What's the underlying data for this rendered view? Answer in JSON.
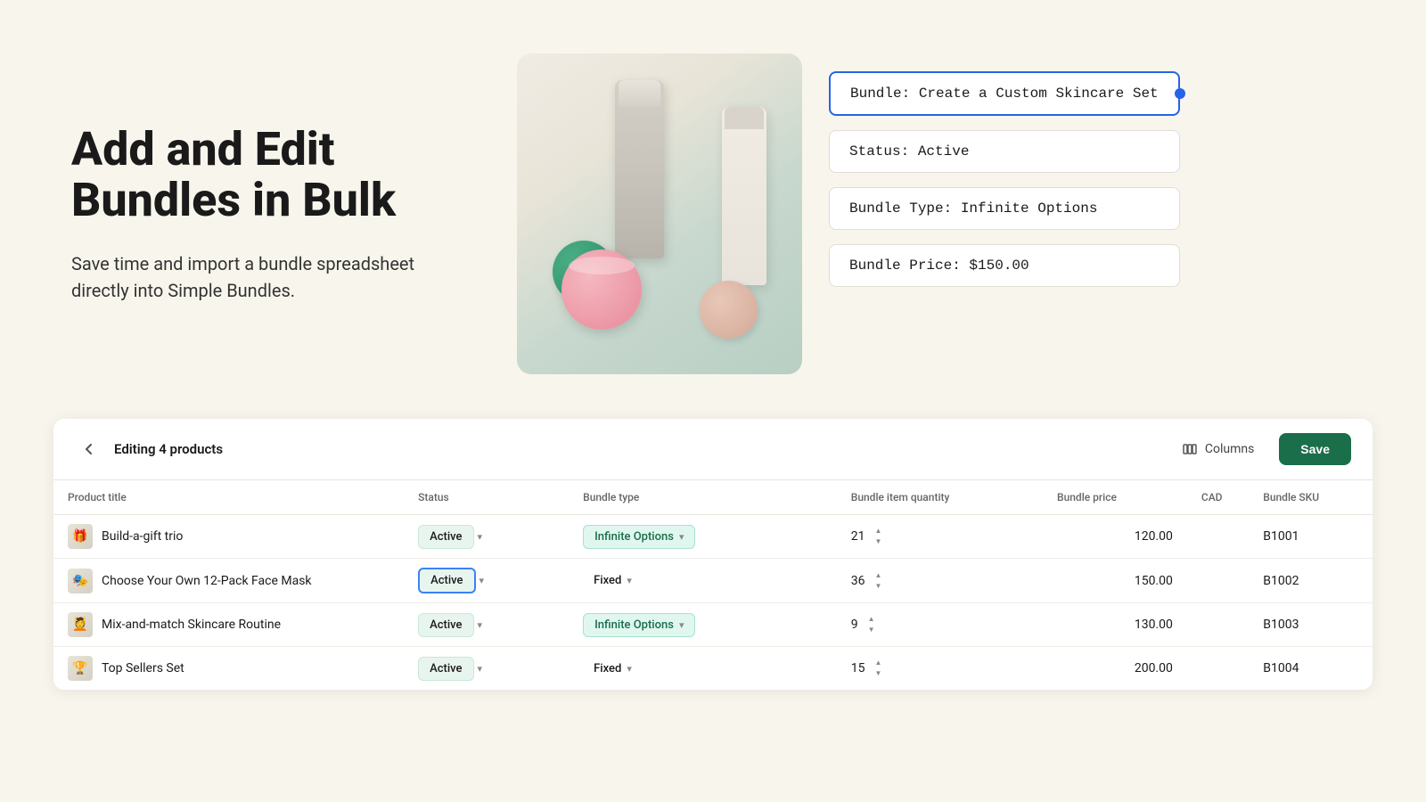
{
  "hero": {
    "title": "Add and Edit Bundles in Bulk",
    "subtitle": "Save time and import a bundle spreadsheet directly into Simple Bundles.",
    "info_cards": [
      {
        "label": "Bundle:",
        "value": "Create a Custom Skincare Set",
        "highlighted": true
      },
      {
        "label": "Status:",
        "value": "Active",
        "highlighted": false
      },
      {
        "label": "Bundle Type:",
        "value": "Infinite Options",
        "highlighted": false
      },
      {
        "label": "Bundle Price:",
        "value": "$150.00",
        "highlighted": false
      }
    ]
  },
  "table": {
    "editing_label": "Editing 4 products",
    "columns_label": "Columns",
    "save_label": "Save",
    "headers": [
      "Product title",
      "Status",
      "Bundle type",
      "Bundle item quantity",
      "Bundle price",
      "CAD",
      "Bundle SKU"
    ],
    "rows": [
      {
        "id": 1,
        "thumb": "🎁",
        "title": "Build-a-gift trio",
        "status": "Active",
        "status_selected": false,
        "bundle_type": "Infinite Options",
        "bundle_type_style": "infinite",
        "quantity": 21,
        "price": "120.00",
        "sku": "B1001"
      },
      {
        "id": 2,
        "thumb": "🎭",
        "title": "Choose Your Own 12-Pack Face Mask",
        "status": "Active",
        "status_selected": true,
        "bundle_type": "Fixed",
        "bundle_type_style": "fixed",
        "quantity": 36,
        "price": "150.00",
        "sku": "B1002"
      },
      {
        "id": 3,
        "thumb": "💆",
        "title": "Mix-and-match Skincare Routine",
        "status": "Active",
        "status_selected": false,
        "bundle_type": "Infinite Options",
        "bundle_type_style": "infinite",
        "quantity": 9,
        "price": "130.00",
        "sku": "B1003"
      },
      {
        "id": 4,
        "thumb": "🏆",
        "title": "Top Sellers Set",
        "status": "Active",
        "status_selected": false,
        "bundle_type": "Fixed",
        "bundle_type_style": "fixed",
        "quantity": 15,
        "price": "200.00",
        "sku": "B1004"
      }
    ]
  }
}
